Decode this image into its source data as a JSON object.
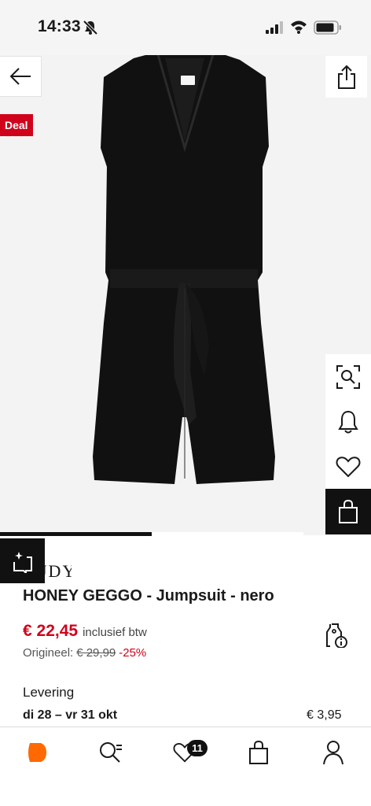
{
  "status_bar": {
    "time": "14:33"
  },
  "product": {
    "deal_badge": "Deal",
    "brand": "JDY",
    "title": "HONEY GEGGO - Jumpsuit - nero",
    "price": "€ 22,45",
    "vat_note": "inclusief btw",
    "original_label": "Origineel:",
    "original_price": "€ 29,99",
    "discount": "-25%",
    "image_color": "#111111",
    "gallery_progress": 0.5
  },
  "delivery": {
    "label": "Levering",
    "dates": "di 28 – vr 31 okt",
    "cost": "€ 3,95"
  },
  "tab_bar": {
    "wishlist_count": "11",
    "accent_color": "#ff6900"
  },
  "icons": [
    "mute-icon",
    "signal-icon",
    "wifi-icon",
    "battery-icon",
    "arrow-left-icon",
    "share-icon",
    "visual-search-icon",
    "bell-icon",
    "heart-icon",
    "bag-icon",
    "similar-items-icon",
    "price-tag-info-icon",
    "zalando-logo-icon",
    "search-list-icon",
    "user-icon"
  ]
}
